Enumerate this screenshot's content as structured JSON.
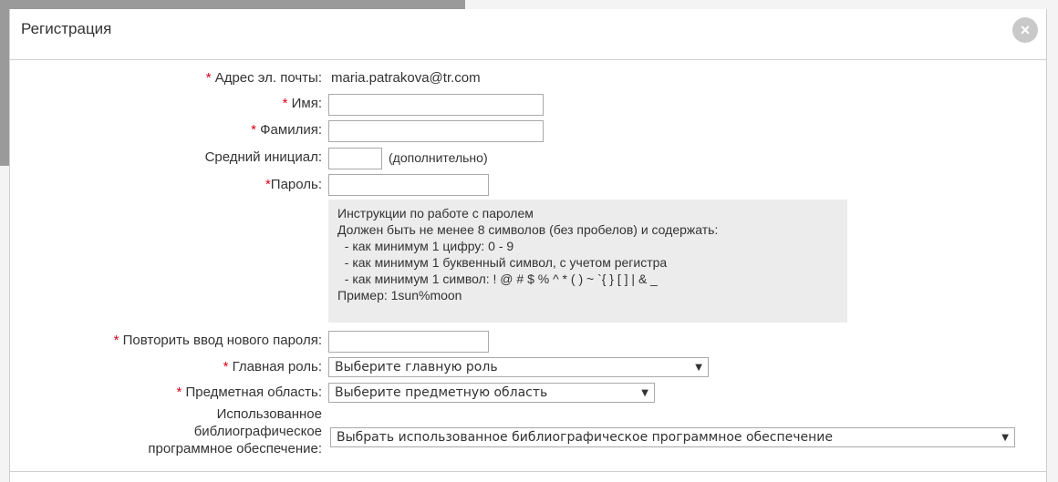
{
  "dialog": {
    "title": "Регистрация",
    "close_icon": "×"
  },
  "form": {
    "email": {
      "required": "*",
      "label": " Адрес эл. почты:",
      "value": "maria.patrakova@tr.com"
    },
    "first_name": {
      "required": "*",
      "label": " Имя:",
      "value": ""
    },
    "last_name": {
      "required": "*",
      "label": " Фамилия:",
      "value": ""
    },
    "middle_initial": {
      "label": "Средний инициал:",
      "value": "",
      "note": "(дополнительно)"
    },
    "password": {
      "required": "*",
      "label": "Пароль:",
      "value": ""
    },
    "password_hint": [
      "Инструкции по работе с паролем",
      "Должен быть не менее 8 символов (без пробелов) и содержать:",
      "  - как минимум 1 цифру: 0 - 9",
      "  - как минимум 1 буквенный символ, с учетом регистра",
      "  - как минимум 1 символ: ! @ # $ % ^ * ( ) ~ `{ } [ ] | & _",
      "Пример: 1sun%moon"
    ],
    "confirm_password": {
      "required": "*",
      "label": " Повторить ввод нового пароля:",
      "value": ""
    },
    "main_role": {
      "required": "*",
      "label": " Главная роль:",
      "selected": "Выберите главную роль"
    },
    "subject_area": {
      "required": "*",
      "label": " Предметная область:",
      "selected": "Выберите предметную область"
    },
    "biblio_software": {
      "label_lines": [
        "Использованное",
        "библиографическое",
        "программное обеспечение:"
      ],
      "selected": "Выбрать использованное библиографическое программное обеспечение"
    },
    "dropdown_arrow": "▼"
  },
  "colors": {
    "required": "#d9001b",
    "hint_bg": "#ececec",
    "close_bg": "#c9c9c9"
  }
}
